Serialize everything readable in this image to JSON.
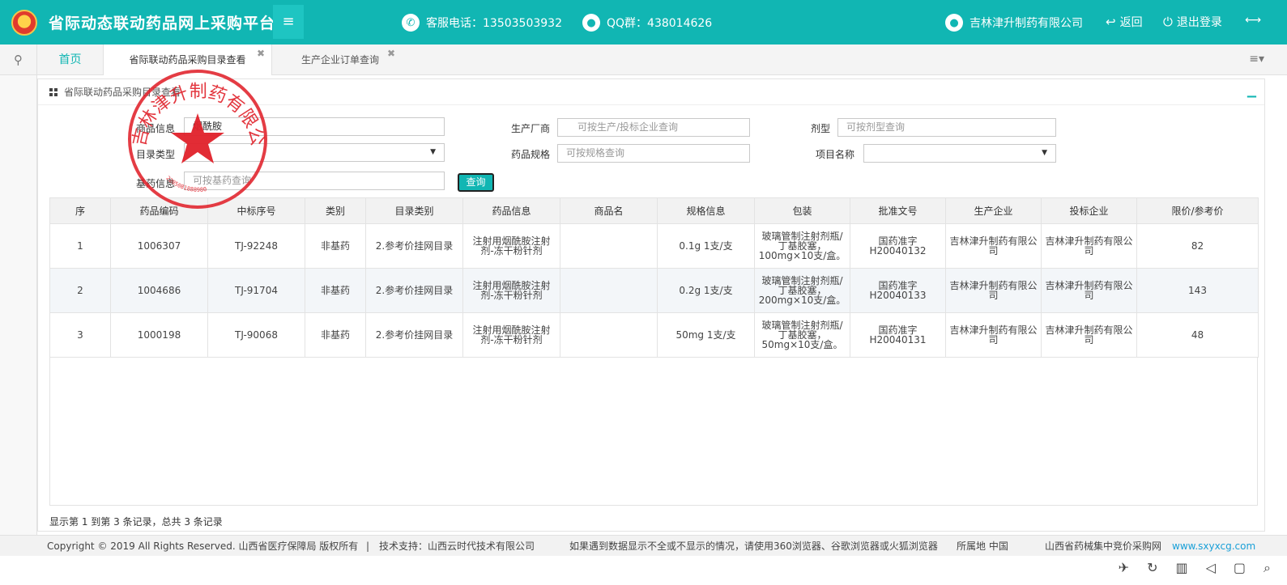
{
  "header": {
    "title": "省际动态联动药品网上采购平台",
    "phone": "客服电话：13503503932",
    "qq": "QQ群：438014626",
    "company": "吉林津升制药有限公司",
    "back": "返回",
    "logout": "退出登录"
  },
  "tabs": {
    "home": "首页",
    "active": "省际联动药品采购目录查看",
    "other": "生产企业订单查询"
  },
  "panel": {
    "title": "省际联动药品采购目录查看"
  },
  "form": {
    "product_info_label": "商品信息",
    "product_info_value": "烟酰胺",
    "catalog_type_label": "目录类型",
    "catalog_type_value": "",
    "basic_drug_label": "基药信息",
    "basic_drug_placeholder": "可按基药查询",
    "manufacturer_label": "生产厂商",
    "manufacturer_placeholder": "可按生产/投标企业查询",
    "spec_label": "药品规格",
    "spec_placeholder": "可按规格查询",
    "dosage_label": "剂型",
    "dosage_placeholder": "可按剂型查询",
    "project_label": "项目名称",
    "project_value": "",
    "query_button": "查询"
  },
  "table": {
    "headers": [
      "序",
      "药品编码",
      "中标序号",
      "类别",
      "目录类别",
      "药品信息",
      "商品名",
      "规格信息",
      "包装",
      "批准文号",
      "生产企业",
      "投标企业",
      "限价/参考价"
    ],
    "rows": [
      [
        "1",
        "1006307",
        "TJ-92248",
        "非基药",
        "2.参考价挂网目录",
        "注射用烟酰胺注射剂-冻干粉针剂",
        "",
        "0.1g 1支/支",
        "玻璃管制注射剂瓶/丁基胶塞，100mg×10支/盒。",
        "国药准字H20040132",
        "吉林津升制药有限公司",
        "吉林津升制药有限公司",
        "82"
      ],
      [
        "2",
        "1004686",
        "TJ-91704",
        "非基药",
        "2.参考价挂网目录",
        "注射用烟酰胺注射剂-冻干粉针剂",
        "",
        "0.2g 1支/支",
        "玻璃管制注射剂瓶/丁基胶塞，200mg×10支/盒。",
        "国药准字H20040133",
        "吉林津升制药有限公司",
        "吉林津升制药有限公司",
        "143"
      ],
      [
        "3",
        "1000198",
        "TJ-90068",
        "非基药",
        "2.参考价挂网目录",
        "注射用烟酰胺注射剂-冻干粉针剂",
        "",
        "50mg 1支/支",
        "玻璃管制注射剂瓶/丁基胶塞，50mg×10支/盒。",
        "国药准字H20040131",
        "吉林津升制药有限公司",
        "吉林津升制药有限公司",
        "48"
      ]
    ],
    "summary": "显示第 1 到第 3 条记录，总共 3 条记录"
  },
  "footer": {
    "copyright": "Copyright © 2019 All Rights Reserved. 山西省医疗保障局 版权所有",
    "tech": "技术支持：山西云时代技术有限公司",
    "notice": "如果遇到数据显示不全或不显示的情况，请使用360浏览器、谷歌浏览器或火狐浏览器",
    "region": "所属地 中国",
    "site_name": "山西省药械集中竞价采购网",
    "site_url": "www.sxyxcg.com"
  },
  "stamp": {
    "text": "吉林津升制药有限公司",
    "code": "2205081888980",
    "color": "#e0212a"
  },
  "colors": {
    "accent": "#11b6b3",
    "link": "#1aa0d8"
  }
}
